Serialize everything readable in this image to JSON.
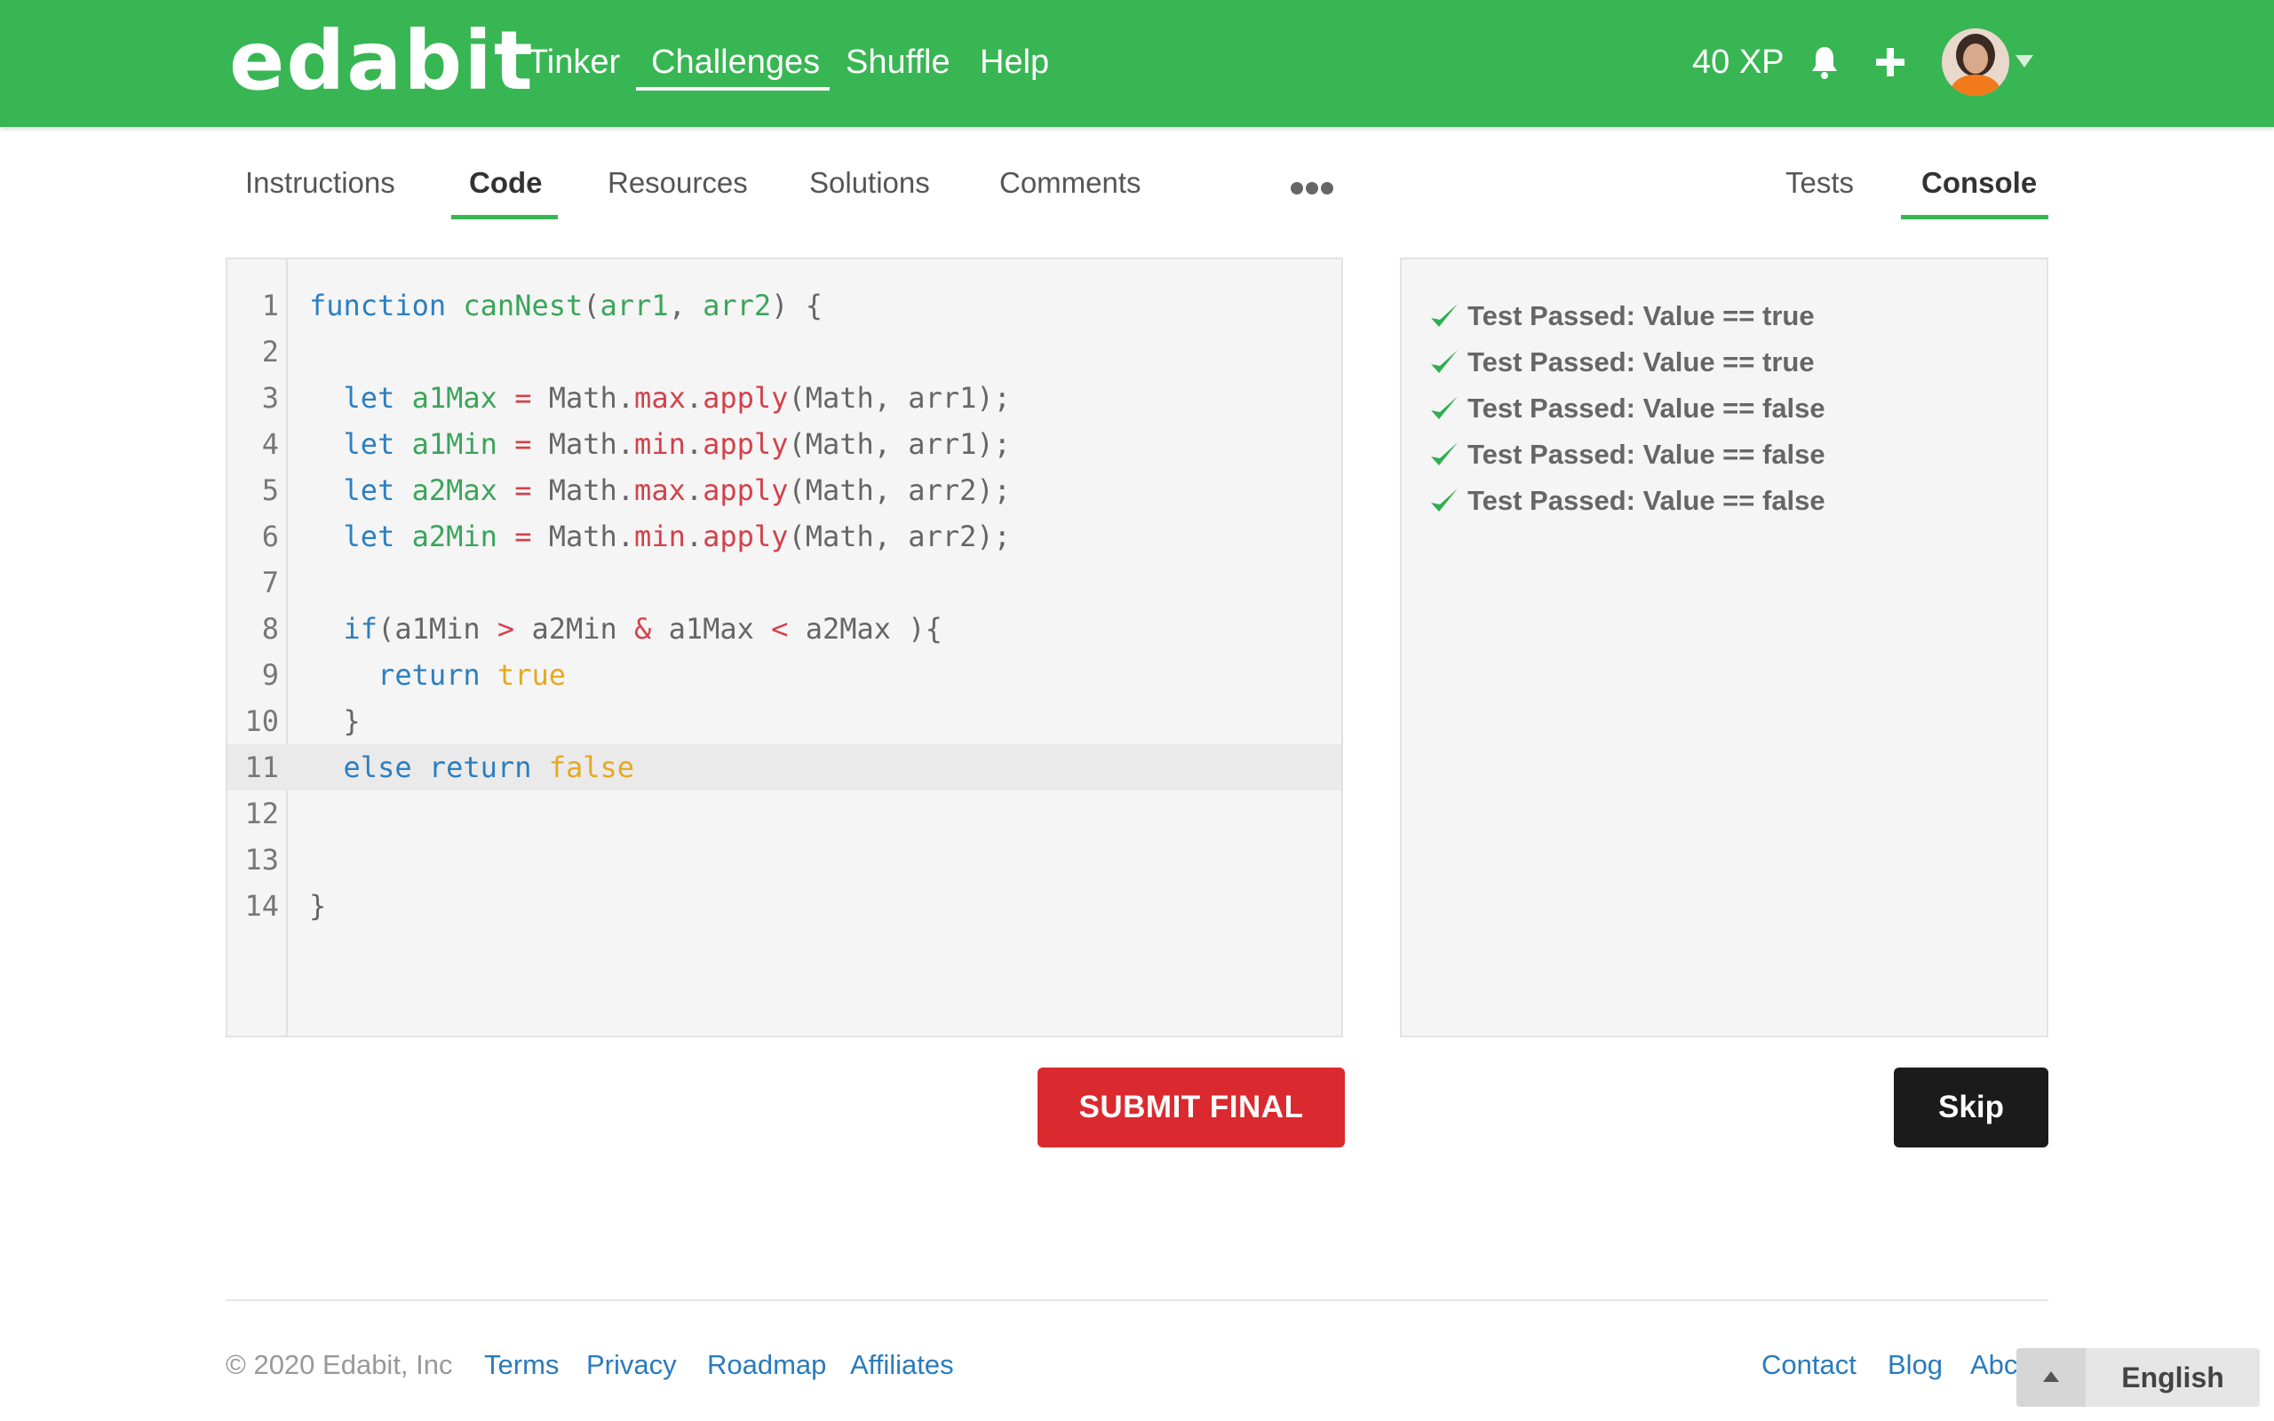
{
  "header": {
    "logo": "edabit",
    "nav": [
      {
        "label": "Tinker"
      },
      {
        "label": "Challenges",
        "active": true
      },
      {
        "label": "Shuffle"
      },
      {
        "label": "Help"
      }
    ],
    "xp": "40 XP",
    "icons": [
      "bell-icon",
      "plus-icon",
      "avatar",
      "chevron-down-icon"
    ],
    "brand_color": "#38b653"
  },
  "tabs": {
    "left": [
      {
        "label": "Instructions"
      },
      {
        "label": "Code",
        "active": true
      },
      {
        "label": "Resources"
      },
      {
        "label": "Solutions"
      },
      {
        "label": "Comments"
      }
    ],
    "right": [
      {
        "label": "Tests"
      },
      {
        "label": "Console",
        "active": true
      }
    ]
  },
  "editor": {
    "current_line": 11,
    "lines": [
      {
        "n": "1",
        "code": "function canNest(arr1, arr2) {"
      },
      {
        "n": "2",
        "code": ""
      },
      {
        "n": "3",
        "code": "  let a1Max = Math.max.apply(Math, arr1);"
      },
      {
        "n": "4",
        "code": "  let a1Min = Math.min.apply(Math, arr1);"
      },
      {
        "n": "5",
        "code": "  let a2Max = Math.max.apply(Math, arr2);"
      },
      {
        "n": "6",
        "code": "  let a2Min = Math.min.apply(Math, arr2);"
      },
      {
        "n": "7",
        "code": ""
      },
      {
        "n": "8",
        "code": "  if(a1Min > a2Min & a1Max < a2Max ){"
      },
      {
        "n": "9",
        "code": "    return true"
      },
      {
        "n": "10",
        "code": "  }"
      },
      {
        "n": "11",
        "code": "  else return false"
      },
      {
        "n": "12",
        "code": ""
      },
      {
        "n": "13",
        "code": ""
      },
      {
        "n": "14",
        "code": "}"
      }
    ]
  },
  "console": {
    "results": [
      "Test Passed: Value == true",
      "Test Passed: Value == true",
      "Test Passed: Value == false",
      "Test Passed: Value == false",
      "Test Passed: Value == false"
    ],
    "pass_color": "#2fae4f"
  },
  "actions": {
    "submit_label": "SUBMIT FINAL",
    "skip_label": "Skip",
    "submit_color": "#db2a2f"
  },
  "footer": {
    "copyright": "© 2020 Edabit, Inc",
    "left_links": [
      "Terms",
      "Privacy",
      "Roadmap",
      "Affiliates"
    ],
    "right_links": [
      "Contact",
      "Blog",
      "Abc"
    ],
    "language": "English"
  }
}
